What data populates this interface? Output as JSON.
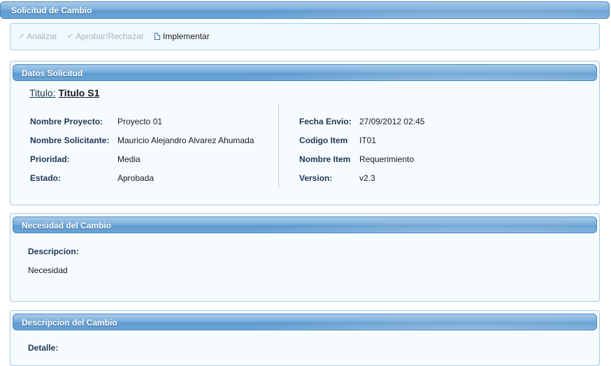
{
  "window": {
    "title": "Solicitud de Cambio"
  },
  "toolbar": {
    "analizar_label": "Analizar",
    "aprobar_label": "Aprobar/Rechazar",
    "implementar_label": "Implementar"
  },
  "datos": {
    "header": "Datos Solicitud",
    "titulo_label": "Titulo:",
    "titulo_value": "Titulo S1",
    "left": [
      {
        "label": "Nombre Proyecto:",
        "value": "Proyecto 01"
      },
      {
        "label": "Nombre Solicitante:",
        "value": "Mauricio Alejandro Alvarez Ahumada"
      },
      {
        "label": "Prioridad:",
        "value": "Media"
      },
      {
        "label": "Estado:",
        "value": "Aprobada"
      }
    ],
    "right": [
      {
        "label": "Fecha Envio:",
        "value": "27/09/2012 02:45"
      },
      {
        "label": "Codigo Item",
        "value": "IT01"
      },
      {
        "label": "Nombre Item",
        "value": "Requerimiento"
      },
      {
        "label": "Version:",
        "value": "v2.3"
      }
    ]
  },
  "necesidad": {
    "header": "Necesidad del Cambio",
    "label": "Descripcion:",
    "value": "Necesidad"
  },
  "descripcion": {
    "header": "Descripcion del Cambio",
    "label": "Detalle:"
  },
  "colors": {
    "bar_blue": "#6aa4d6",
    "label_navy": "#1f3653",
    "panel_border": "#a6cbe6"
  }
}
